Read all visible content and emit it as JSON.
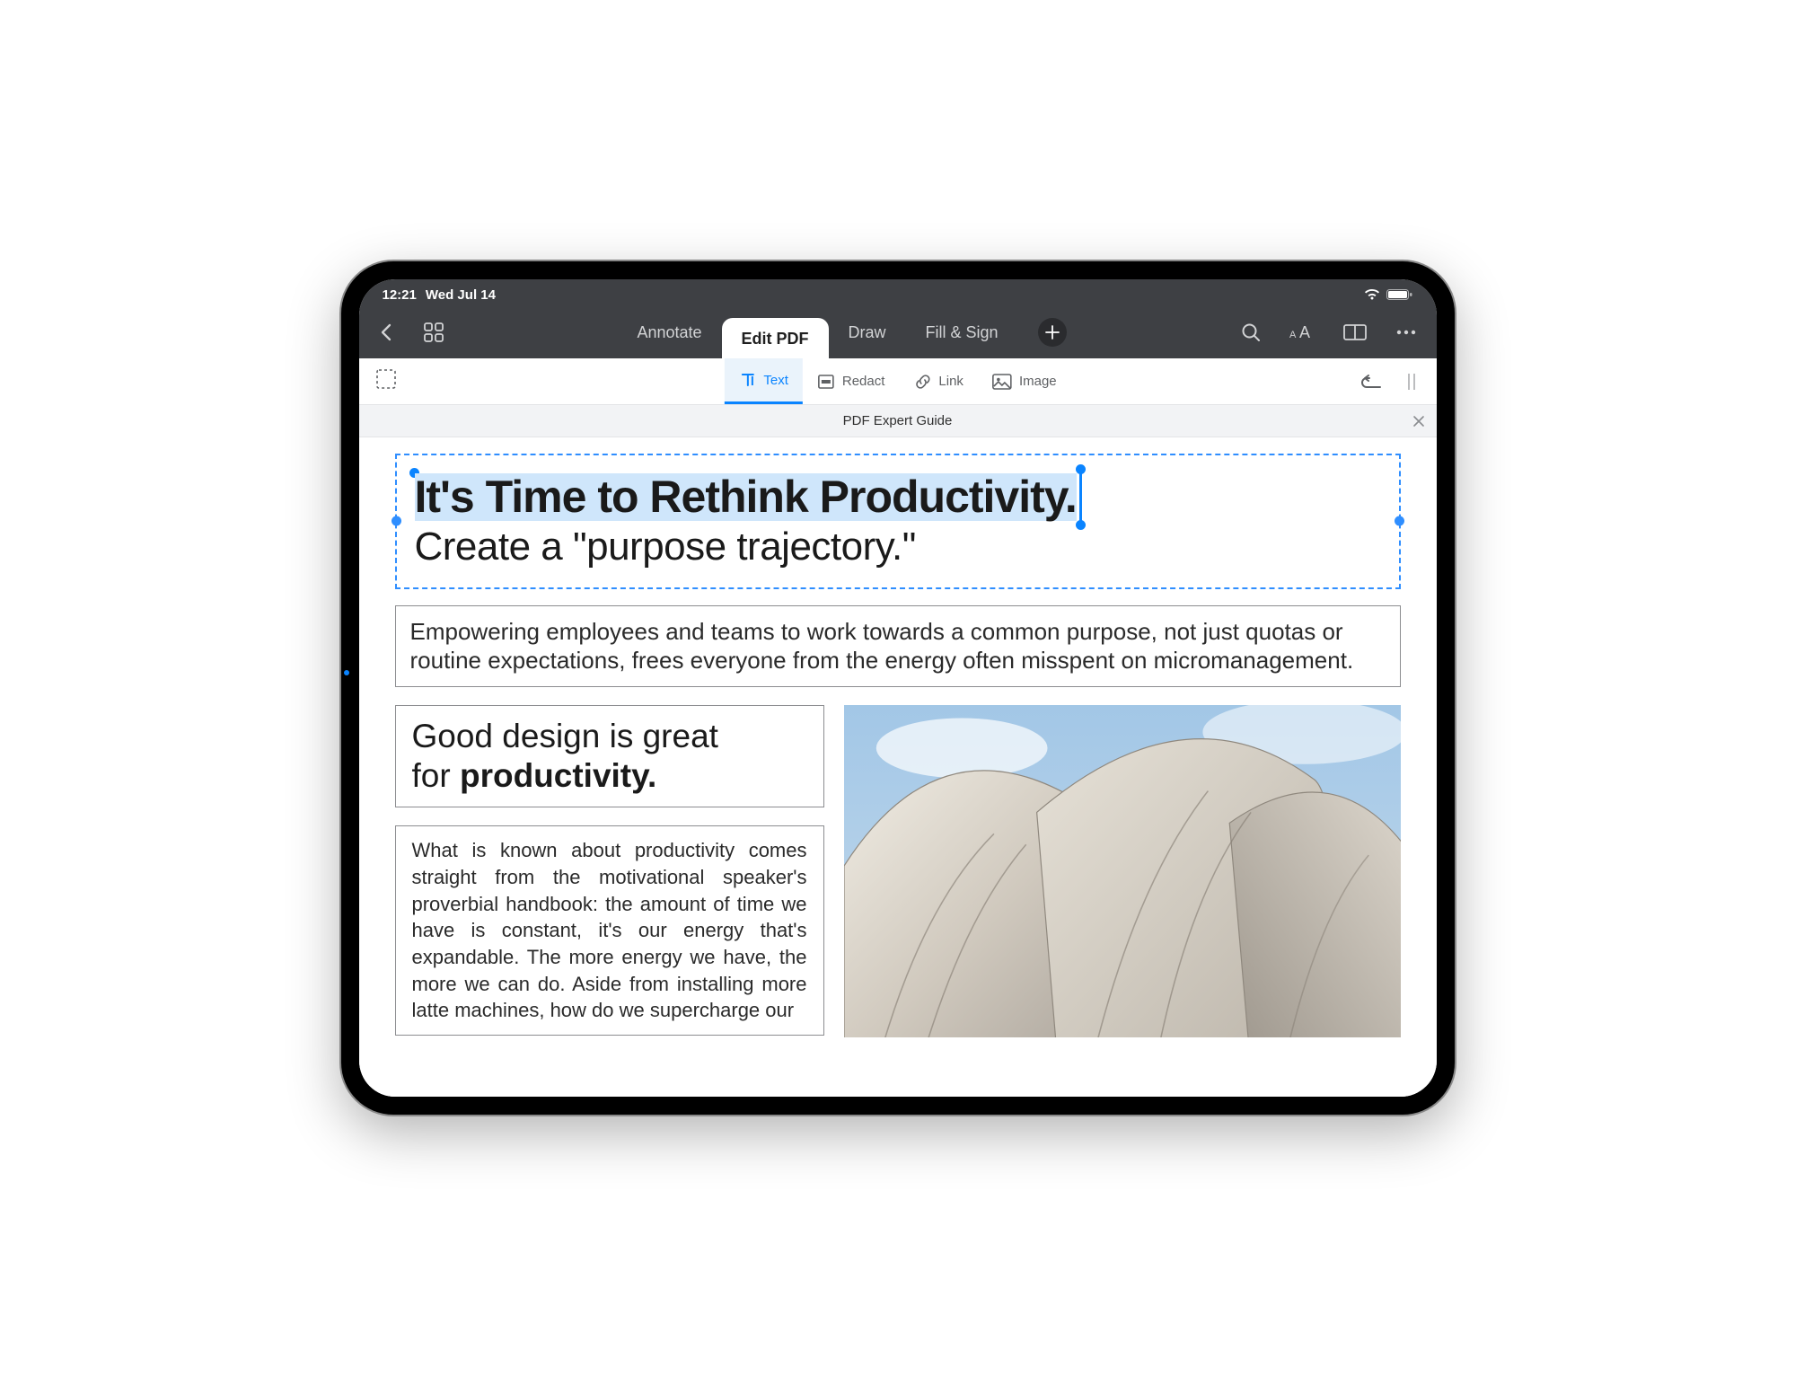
{
  "status": {
    "time": "12:21",
    "date": "Wed Jul 14"
  },
  "topTabs": {
    "annotate": "Annotate",
    "editpdf": "Edit PDF",
    "draw": "Draw",
    "fillsign": "Fill & Sign"
  },
  "tools": {
    "text": "Text",
    "redact": "Redact",
    "link": "Link",
    "image": "Image"
  },
  "file": {
    "title": "PDF Expert Guide"
  },
  "doc": {
    "hero_bold": "It's Time to Rethink Productivity.",
    "hero_sub": "Create a \"purpose trajectory.\"",
    "intro_para": "Empowering employees and teams to work towards a common purpose, not just quotas or routine expectations, frees everyone from the energy often misspent on micromanagement.",
    "design_heading_1": "Good design is great",
    "design_heading_2_pre": "for ",
    "design_heading_2_bold": "productivity.",
    "body_para": "What is known about productivity comes straight from the motivational speaker's proverbial handbook: the amount of time we have is constant, it's our energy that's expandable. The more energy we have, the more we can do. Aside from installing more latte machines, how do we supercharge our"
  }
}
